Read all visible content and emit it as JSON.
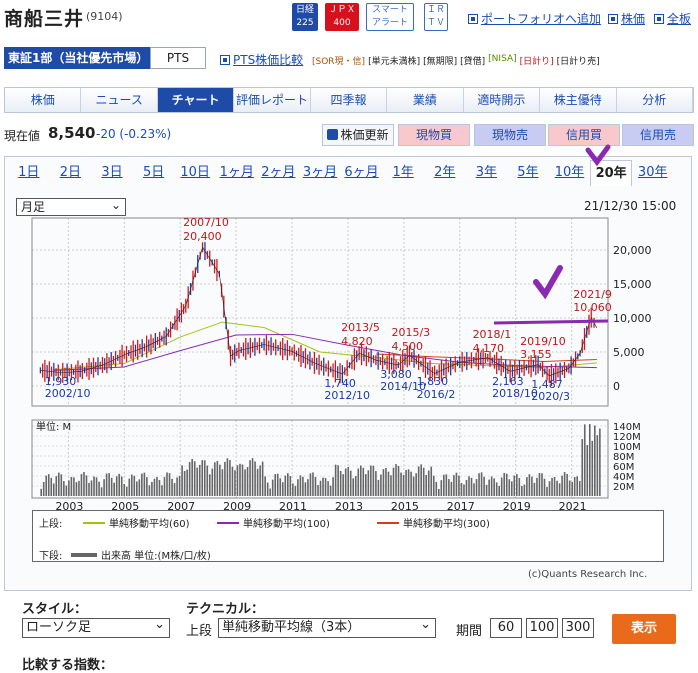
{
  "header": {
    "title": "商船三井",
    "code": "(9104)",
    "nikkei": [
      "日経",
      "225"
    ],
    "jpx": [
      "ＪＰＸ",
      "400"
    ],
    "smart": [
      "スマート",
      "アラート"
    ],
    "irtv": [
      "ＩＲ",
      "ＴＶ"
    ],
    "portfolio": "ポートフォリオへ追加",
    "price_link": "株価",
    "board_link": "全板"
  },
  "market": {
    "primary": "東証1部（当社優先市場）",
    "pts": "PTS",
    "pts_compare": "PTS株価比較",
    "tags": [
      "[SOR現・信]",
      "[単元未満株]",
      "[無期限]",
      "[貸借]",
      "[NISA]",
      "[日計り]",
      "[日計り売]"
    ]
  },
  "nav": {
    "tabs": [
      "株価",
      "ニュース",
      "チャート",
      "評価レポート",
      "四季報",
      "業績",
      "適時開示",
      "株主優待",
      "分析"
    ],
    "active": 2
  },
  "price": {
    "label": "現在値",
    "value": "8,540",
    "change": "-20 (-0.23%)",
    "update_btn": "株価更新",
    "buy_cash": "現物買",
    "sell_cash": "現物売",
    "buy_margin": "信用買",
    "sell_margin": "信用売"
  },
  "periods": {
    "items": [
      "1日",
      "2日",
      "3日",
      "5日",
      "10日",
      "1ヶ月",
      "2ヶ月",
      "3ヶ月",
      "6ヶ月",
      "1年",
      "2年",
      "3年",
      "5年",
      "10年",
      "20年",
      "30年"
    ],
    "active": 14
  },
  "chart_controls": {
    "interval": "月足",
    "datetime": "21/12/30 15:00"
  },
  "chart_data": {
    "type": "line",
    "y_ticks": [
      "20,000",
      "15,000",
      "10,000",
      "5,000",
      "0"
    ],
    "vol_ticks": [
      "140M",
      "120M",
      "100M",
      "80M",
      "60M",
      "40M",
      "20M"
    ],
    "vol_unit": "単位: M",
    "x_ticks": [
      "2003",
      "2005",
      "2007",
      "2009",
      "2011",
      "2013",
      "2015",
      "2017",
      "2019",
      "2021"
    ],
    "annotations_red": [
      [
        "2007/10",
        "20,400"
      ],
      [
        "2013/5",
        "4,820"
      ],
      [
        "2015/3",
        "4,500"
      ],
      [
        "2018/1",
        "4,170"
      ],
      [
        "2019/10",
        "3,155"
      ],
      [
        "2021/9",
        "10,060"
      ]
    ],
    "annotations_blue": [
      [
        "1,930",
        "2002/10"
      ],
      [
        "1,740",
        "2012/10"
      ],
      [
        "3,080",
        "2014/10"
      ],
      [
        "1,830",
        "2016/2"
      ],
      [
        "2,163",
        "2018/10"
      ],
      [
        "1,487",
        "2020/3"
      ]
    ],
    "series": [
      {
        "name": "ローソク足",
        "x": [
          2002.0,
          2002.8,
          2003.5,
          2004.3,
          2005.0,
          2005.8,
          2006.5,
          2007.2,
          2007.8,
          2008.4,
          2008.8,
          2009.1,
          2010.0,
          2011.0,
          2011.8,
          2012.8,
          2013.4,
          2014.0,
          2014.8,
          2015.2,
          2016.1,
          2017.0,
          2018.0,
          2018.8,
          2019.8,
          2020.2,
          2020.9,
          2021.3,
          2021.7,
          2021.9
        ],
        "values": [
          2300,
          1930,
          2200,
          3200,
          4600,
          5800,
          7300,
          11800,
          20400,
          16500,
          4400,
          5200,
          6100,
          5100,
          3400,
          1740,
          4820,
          3800,
          3080,
          4500,
          1830,
          3500,
          4170,
          2163,
          3155,
          1487,
          2600,
          4800,
          10060,
          8540
        ]
      },
      {
        "name": "単純移動平均(60)",
        "values": []
      },
      {
        "name": "単純移動平均(100)",
        "values": []
      },
      {
        "name": "単純移動平均(300)",
        "values": []
      }
    ],
    "ylim": [
      0,
      23000
    ]
  },
  "legend": {
    "upper": "上段:",
    "lower": "下段:",
    "ma60": "単純移動平均(60)",
    "ma100": "単純移動平均(100)",
    "ma300": "単純移動平均(300)",
    "volume": "出来高 単位:(M株/口/枚)",
    "colors": {
      "ma60": "#a7c018",
      "ma100": "#8a2ab0",
      "ma300": "#d04020",
      "volume": "#666666"
    }
  },
  "copyright": "(c)Quants Research Inc.",
  "controls": {
    "style_label": "スタイル：",
    "style_value": "ローソク足",
    "tech_label": "テクニカル：",
    "upper_label": "上段",
    "tech_value": "単純移動平均線（3本）",
    "period_label": "期間",
    "periods": [
      "60",
      "100",
      "300"
    ],
    "show_btn": "表示",
    "compare_label": "比較する指数："
  }
}
